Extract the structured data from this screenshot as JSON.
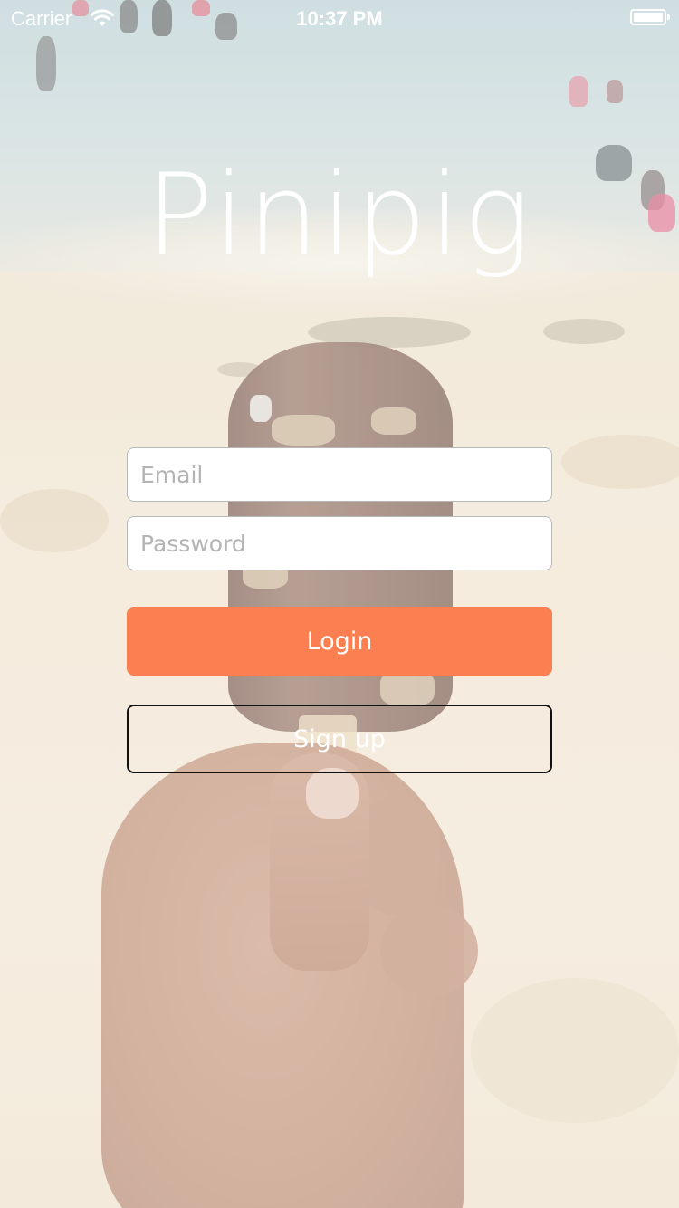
{
  "status_bar": {
    "carrier": "Carrier",
    "time": "10:37 PM",
    "wifi_icon": "wifi-icon",
    "battery_icon": "battery-icon",
    "battery_level": 1.0
  },
  "app": {
    "title": "Pinipig"
  },
  "login_form": {
    "email_placeholder": "Email",
    "email_value": "",
    "password_placeholder": "Password",
    "password_value": "",
    "login_label": "Login",
    "signup_label": "Sign up"
  },
  "colors": {
    "accent": "#fb7f50",
    "text_on_background": "#ffffff",
    "signup_border": "#111111"
  },
  "background": {
    "description_icon": "beach-photo"
  }
}
